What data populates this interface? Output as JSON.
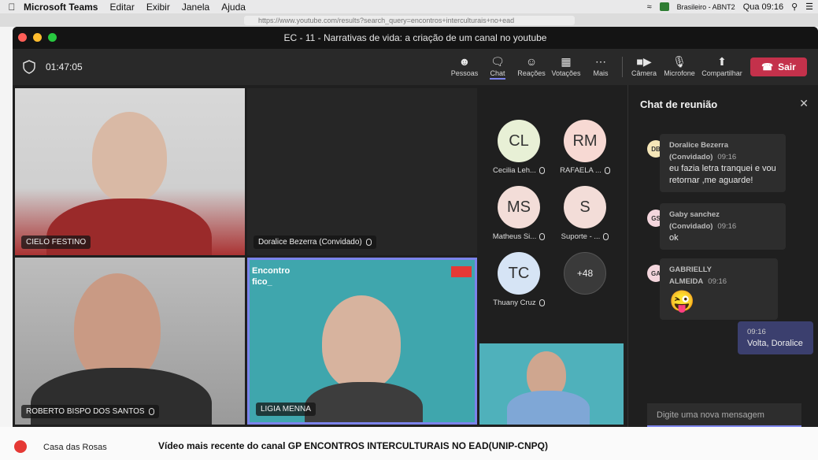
{
  "menubar": {
    "app": "Microsoft Teams",
    "items": [
      "Editar",
      "Exibir",
      "Janela",
      "Ajuda"
    ],
    "keyboard": "Brasileiro - ABNT2",
    "clock": "Qua 09:16"
  },
  "browser": {
    "url": "https://www.youtube.com/results?search_query=encontros+interculturais+no+ead"
  },
  "window": {
    "title": "EC - 11 - Narrativas de vida: a criação de um canal no youtube"
  },
  "toolbar": {
    "timer": "01:47:05",
    "buttons": [
      {
        "label": "Pessoas",
        "icon": "people-icon"
      },
      {
        "label": "Chat",
        "icon": "chat-icon"
      },
      {
        "label": "Reações",
        "icon": "reactions-icon"
      },
      {
        "label": "Votações",
        "icon": "polls-icon"
      },
      {
        "label": "Mais",
        "icon": "more-icon"
      },
      {
        "label": "Câmera",
        "icon": "camera-icon"
      },
      {
        "label": "Microfone",
        "icon": "mic-off-icon"
      },
      {
        "label": "Compartilhar",
        "icon": "share-icon"
      }
    ],
    "leave_label": "Sair",
    "accent": "#7b83eb",
    "leave_color": "#c4314b"
  },
  "tiles": [
    {
      "name": "CIELO FESTINO"
    },
    {
      "name": "Doralice Bezerra (Convidado)"
    },
    {
      "name": "ROBERTO BISPO DOS SANTOS"
    },
    {
      "name": "LIGIA MENNA"
    }
  ],
  "tile_overlay_text": {
    "encontro": "Encontro",
    "fico": "fico_"
  },
  "roster": [
    {
      "initials": "CL",
      "name": "Cecilia Leh...",
      "color": "#e8f0d6"
    },
    {
      "initials": "RM",
      "name": "RAFAELA ...",
      "color": "#f7d9d3"
    },
    {
      "initials": "MS",
      "name": "Matheus Si...",
      "color": "#f3ddd8"
    },
    {
      "initials": "S",
      "name": "Suporte - ...",
      "color": "#f3ddd8"
    },
    {
      "initials": "TC",
      "name": "Thuany Cruz",
      "color": "#d6e4f5"
    },
    {
      "initials": "+48",
      "name": "",
      "color": "#3a3a3a"
    }
  ],
  "chat": {
    "title": "Chat de reunião",
    "messages": [
      {
        "initials": "DB",
        "author": "Doralice Bezerra (Convidado)",
        "time": "09:16",
        "text": "eu fazia letra tranquei e vou retornar ,me aguarde!",
        "avatar_color": "#f5e6b8"
      },
      {
        "initials": "GS",
        "author": "Gaby sanchez (Convidado)",
        "time": "09:16",
        "text": "ok",
        "avatar_color": "#f4d6dd"
      },
      {
        "initials": "GA",
        "author": "GABRIELLY ALMEIDA",
        "time": "09:16",
        "text": "😜",
        "avatar_color": "#f4d6dd"
      }
    ],
    "own_message": {
      "time": "09:16",
      "text": "Volta, Doralice"
    },
    "compose_placeholder": "Digite uma nova mensagem"
  },
  "page": {
    "channel": "Casa das Rosas",
    "video_title": "Vídeo mais recente do canal GP ENCONTROS INTERCULTURAIS NO EAD(UNIP-CNPQ)"
  }
}
